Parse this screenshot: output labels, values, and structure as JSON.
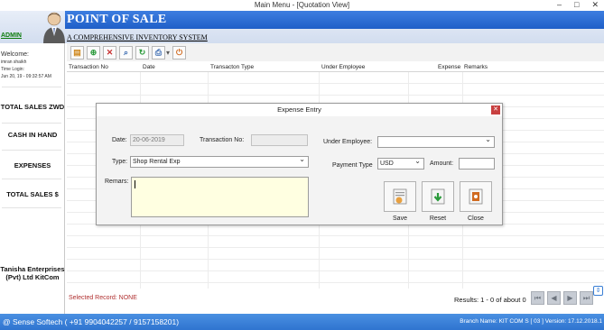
{
  "window": {
    "title": "Main Menu - [Quotation View]"
  },
  "banner": {
    "title": "POINT OF SALE",
    "tagline": "A COMPREHENSIVE INVENTORY SYSTEM",
    "user_link": "ADMIN"
  },
  "sidebar": {
    "welcome": "Welcome:",
    "user": "imran shaikh",
    "time_label": "Time Login:",
    "time_value": "Jun 20, 19 - 09:32:57 AM",
    "items": [
      {
        "label": "TOTAL SALES ZWD"
      },
      {
        "label": "CASH IN HAND"
      },
      {
        "label": "EXPENSES"
      },
      {
        "label": "TOTAL SALES $"
      }
    ],
    "company": "Tanisha Enterprises (Pvt) Ltd KitCom"
  },
  "grid": {
    "columns": [
      "Transaction No",
      "Date",
      "Transacton Type",
      "Under Employee",
      "Expense",
      "Remarks"
    ]
  },
  "footer": {
    "selected": "Selected Record: NONE",
    "results": "Results: 1 - 0 of about 0"
  },
  "status": {
    "left": "@ Sense Softech ( +91 9904042257 / 9157158201)",
    "right": "Branch Name: KIT COM S [ 03 ] Version: 17.12.2018.1"
  },
  "dialog": {
    "title": "Expense Entry",
    "date_label": "Date:",
    "date_value": "20-06-2019",
    "txn_label": "Transaction No:",
    "txn_value": "",
    "emp_label": "Under Employee:",
    "emp_value": "",
    "type_label": "Type:",
    "type_value": "Shop Rental Exp",
    "pay_label": "Payment Type",
    "pay_value": "USD",
    "amount_label": "Amount:",
    "amount_value": "",
    "remarks_label": "Remars:",
    "save": "Save",
    "reset": "Reset",
    "close": "Close"
  },
  "colors": {
    "accent_blue": "#2f74d0",
    "remarks_bg": "#ffffe1",
    "close_red": "#c84040"
  }
}
